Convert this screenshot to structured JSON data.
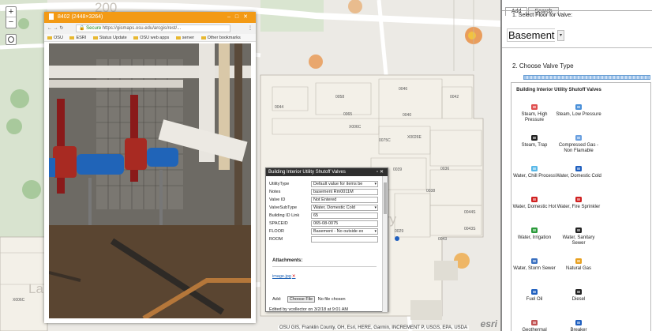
{
  "map": {
    "zoom_in": "+",
    "zoom_out": "−",
    "attribution": "OSU GIS, Franklin County, OH, Esri, HERE, Garmin, INCREMENT P, USGS, EPA, USDA",
    "esri_logo": "esri",
    "road_label": "200",
    "rooms": [
      "0046",
      "0058",
      "0042",
      "0044",
      "0065",
      "0040",
      "X006C",
      "0075C",
      "X0026E",
      "0036",
      "0038",
      "0039",
      "0044S",
      "0043S",
      "0043",
      "0029",
      "X006C"
    ],
    "partial_labels": [
      "ry",
      "La"
    ]
  },
  "browser": {
    "title": "8402 (2448×3264)",
    "url_secure": "Secure",
    "url": "https://gismaps.osu.edu/arcgis/rest/...",
    "bookmarks": [
      "OSU",
      "ESRI",
      "Status Update",
      "OSU web apps",
      "server",
      "Other bookmarks"
    ]
  },
  "popup": {
    "title": "Building Interior Utility Shutoff Valves",
    "fields": [
      {
        "label": "UtilityType",
        "value": "Default value for items be",
        "select": true
      },
      {
        "label": "Notes",
        "value": "basement Rm0011M",
        "select": false
      },
      {
        "label": "Valve ID",
        "value": "Not Entered",
        "select": false
      },
      {
        "label": "ValveSubType",
        "value": "Water, Domestic Cold",
        "select": true
      },
      {
        "label": "Building ID Link",
        "value": "65",
        "select": false
      },
      {
        "label": "SPACEID",
        "value": "065-08-0075",
        "select": false
      },
      {
        "label": "FLOOR",
        "value": "Basement - No outside ex",
        "select": true
      },
      {
        "label": "ROOM",
        "value": "",
        "select": false
      }
    ],
    "attachments_label": "Attachments:",
    "attachment_file": "image.jpg",
    "add_label": "Add:",
    "choose_file": "Choose File",
    "no_file": "No file chosen",
    "edited_by": "Edited by vcollector on 3/2/18 at 9:01 AM"
  },
  "panel": {
    "tabs": [
      "Add",
      "Search"
    ],
    "active_tab": "Add",
    "step1": "1. Select Floor for Valve:",
    "floor_value": "Basement",
    "step2": "2. Choose Valve Type",
    "legend_title": "Building Interior Utility Shutoff Valves",
    "legend_items": [
      {
        "label": "Steam, High Pressure",
        "icon": "steam-high-icon",
        "color": "#e05050"
      },
      {
        "label": "Steam, Low Pressure",
        "icon": "steam-low-icon",
        "color": "#4a90d9"
      },
      {
        "label": "Steam, Trap",
        "icon": "steam-trap-icon",
        "color": "#222222"
      },
      {
        "label": "Compressed Gas - Non Flamable",
        "icon": "compressed-gas-icon",
        "color": "#6aa0e0"
      },
      {
        "label": "Water, Chill Process",
        "icon": "water-chill-icon",
        "color": "#58b8e8"
      },
      {
        "label": "Water, Domestic Cold",
        "icon": "water-cold-icon",
        "color": "#1f5fbf"
      },
      {
        "label": "Water, Domestic Hot",
        "icon": "water-hot-icon",
        "color": "#d02020"
      },
      {
        "label": "Water, Fire Sprinkler",
        "icon": "fire-sprinkler-icon",
        "color": "#d02020"
      },
      {
        "label": "Water, Irrigation",
        "icon": "irrigation-icon",
        "color": "#2a9a3a"
      },
      {
        "label": "Water, Sanitary Sewer",
        "icon": "sanitary-sewer-icon",
        "color": "#222222"
      },
      {
        "label": "Water, Storm Sewer",
        "icon": "storm-sewer-icon",
        "color": "#3a70c0"
      },
      {
        "label": "Natural Gas",
        "icon": "natural-gas-icon",
        "color": "#e8a020"
      },
      {
        "label": "Fuel Oil",
        "icon": "fuel-oil-icon",
        "color": "#1f5fbf"
      },
      {
        "label": "Diesel",
        "icon": "diesel-icon",
        "color": "#222222"
      },
      {
        "label": "Geothermal",
        "icon": "geothermal-icon",
        "color": "#c05050"
      },
      {
        "label": "Breaker",
        "icon": "breaker-icon",
        "color": "#1f5fbf"
      }
    ]
  }
}
